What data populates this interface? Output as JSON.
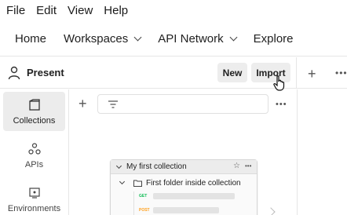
{
  "menubar": [
    "File",
    "Edit",
    "View",
    "Help"
  ],
  "header": {
    "home": "Home",
    "workspaces": "Workspaces",
    "api_network": "API Network",
    "explore": "Explore"
  },
  "workspace": {
    "name": "Present",
    "new_label": "New",
    "import_label": "Import"
  },
  "sidebar": {
    "items": [
      {
        "label": "Collections",
        "icon": "collections-icon",
        "active": true
      },
      {
        "label": "APIs",
        "icon": "apis-icon",
        "active": false
      },
      {
        "label": "Environments",
        "icon": "environments-icon",
        "active": false
      }
    ]
  },
  "collection_preview": {
    "title": "My first collection",
    "folder": "First folder inside collection",
    "requests": [
      {
        "method": "GET",
        "color": "#0cbb52"
      },
      {
        "method": "POST",
        "color": "#ff9f1c"
      }
    ]
  },
  "colors": {
    "get": "#0cbb52",
    "post": "#ff9f1c"
  }
}
